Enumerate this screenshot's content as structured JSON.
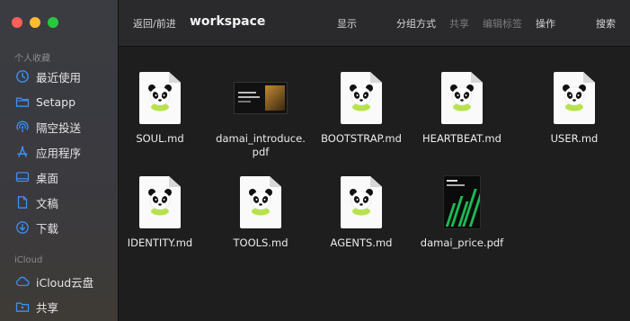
{
  "toolbar": {
    "nav": "返回/前进",
    "title": "workspace",
    "view": "显示",
    "group": "分组方式",
    "share": "共享",
    "edit_tags": "编辑标签",
    "action": "操作",
    "search": "搜索"
  },
  "sidebar": {
    "favorites_title": "个人收藏",
    "favorites": [
      {
        "label": "最近使用",
        "icon": "clock-icon"
      },
      {
        "label": "Setapp",
        "icon": "folder-icon"
      },
      {
        "label": "隔空投送",
        "icon": "airdrop-icon"
      },
      {
        "label": "应用程序",
        "icon": "applications-icon"
      },
      {
        "label": "桌面",
        "icon": "desktop-icon"
      },
      {
        "label": "文稿",
        "icon": "document-icon"
      },
      {
        "label": "下载",
        "icon": "download-icon"
      }
    ],
    "icloud_title": "iCloud",
    "icloud": [
      {
        "label": "iCloud云盘",
        "icon": "cloud-icon"
      },
      {
        "label": "共享",
        "icon": "shared-folder-icon"
      }
    ]
  },
  "files": [
    {
      "name": "SOUL.md",
      "kind": "md"
    },
    {
      "name": "damai_introduce.\npdf",
      "kind": "pdf-intro"
    },
    {
      "name": "BOOTSTRAP.md",
      "kind": "md"
    },
    {
      "name": "HEARTBEAT.md",
      "kind": "md"
    },
    {
      "name": "USER.md",
      "kind": "md"
    },
    {
      "name": "IDENTITY.md",
      "kind": "md"
    },
    {
      "name": "TOOLS.md",
      "kind": "md"
    },
    {
      "name": "AGENTS.md",
      "kind": "md"
    },
    {
      "name": "damai_price.pdf",
      "kind": "pdf-price"
    }
  ],
  "colors": {
    "background": "#1e1e1e",
    "sidebar_icon": "#3d8ff5",
    "panda_accent": "#b6e34d"
  }
}
